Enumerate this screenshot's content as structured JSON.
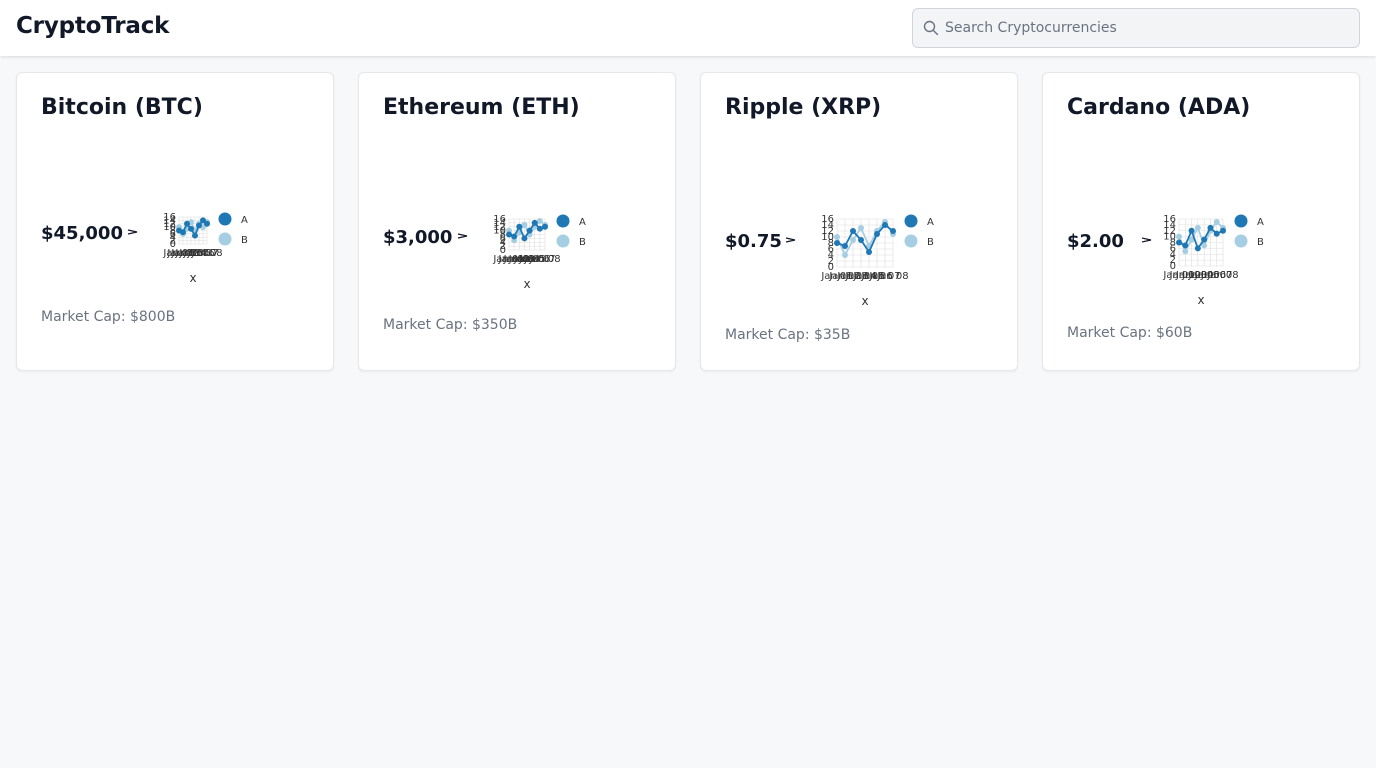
{
  "app": {
    "title": "CryptoTrack"
  },
  "search": {
    "placeholder": "Search Cryptocurrencies",
    "icon": "search-icon"
  },
  "colors": {
    "series_a": "#1f78b4",
    "series_b": "#a6cee3",
    "grid": "#dddddd"
  },
  "cards": [
    {
      "title": "Bitcoin (BTC)",
      "price": "$45,000",
      "market_cap": "Market Cap: $800B",
      "chart_data": {
        "type": "line",
        "x": [
          "Jan 01",
          "Jan 02",
          "Jan 03",
          "Jan 04",
          "Jan 05",
          "Jan 06",
          "Jan 07",
          "Jan 08"
        ],
        "xlabel": "x",
        "ylim": [
          0,
          16
        ],
        "yticks": [
          0,
          2,
          4,
          6,
          8,
          10,
          12,
          14,
          16
        ],
        "series": [
          {
            "name": "A",
            "values": [
              8,
              7,
              12,
              9,
              5,
              11,
              14,
              12
            ]
          },
          {
            "name": "B",
            "values": [
              10,
              6,
              9,
              13,
              8,
              12,
              10,
              13
            ]
          }
        ],
        "legend": "right"
      }
    },
    {
      "title": "Ethereum (ETH)",
      "price": "$3,000",
      "market_cap": "Market Cap: $350B",
      "chart_data": {
        "type": "line",
        "x": [
          "Jan 01",
          "Jan 02",
          "Jan 03",
          "Jan 04",
          "Jan 05",
          "Jan 06",
          "Jan 07",
          "Jan 08"
        ],
        "xlabel": "x",
        "ylim": [
          0,
          16
        ],
        "yticks": [
          0,
          2,
          4,
          6,
          8,
          10,
          12,
          14,
          16
        ],
        "series": [
          {
            "name": "A",
            "values": [
              8,
              7,
              12,
              6,
              10,
              14,
              11,
              12
            ]
          },
          {
            "name": "B",
            "values": [
              10,
              5,
              9,
              13,
              8,
              12,
              15,
              13
            ]
          }
        ],
        "legend": "right"
      }
    },
    {
      "title": "Ripple (XRP)",
      "price": "$0.75",
      "market_cap": "Market Cap: $35B",
      "chart_data": {
        "type": "line",
        "x": [
          "Jan 01",
          "Jan 02",
          "Jan 03",
          "Jan 04",
          "Jan 05",
          "Jan 06",
          "Jan 07",
          "Jan 08"
        ],
        "xlabel": "x",
        "ylim": [
          0,
          16
        ],
        "yticks": [
          0,
          2,
          4,
          6,
          8,
          10,
          12,
          14,
          16
        ],
        "series": [
          {
            "name": "A",
            "values": [
              8,
              7,
              12,
              9,
              5,
              11,
              14,
              12
            ]
          },
          {
            "name": "B",
            "values": [
              10,
              4,
              9,
              13,
              7,
              12,
              15,
              11
            ]
          }
        ],
        "legend": "right"
      }
    },
    {
      "title": "Cardano (ADA)",
      "price": "$2.00",
      "market_cap": "Market Cap: $60B",
      "chart_data": {
        "type": "line",
        "x": [
          "Jan 01",
          "Jan 02",
          "Jan 03",
          "Jan 04",
          "Jan 05",
          "Jan 06",
          "Jan 07",
          "Jan 08"
        ],
        "xlabel": "x",
        "ylim": [
          0,
          16
        ],
        "yticks": [
          0,
          2,
          4,
          6,
          8,
          10,
          12,
          14,
          16
        ],
        "series": [
          {
            "name": "A",
            "values": [
              8,
              7,
              12,
              6,
              9,
              13,
              11,
              12
            ]
          },
          {
            "name": "B",
            "values": [
              10,
              5,
              9,
              13,
              7,
              12,
              15,
              13
            ]
          }
        ],
        "legend": "right"
      }
    }
  ]
}
